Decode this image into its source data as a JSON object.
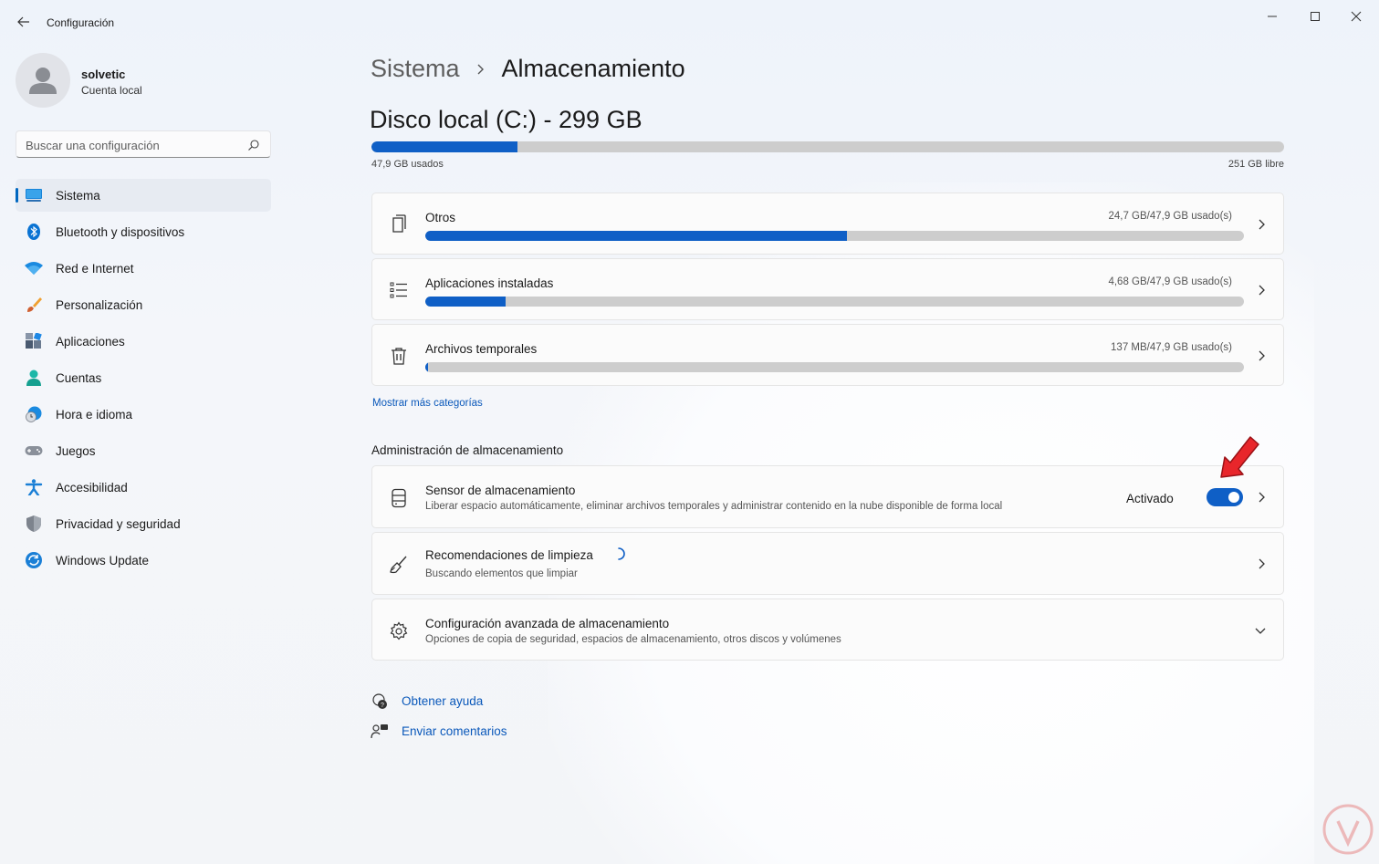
{
  "window": {
    "title": "Configuración",
    "controls": [
      "minimize",
      "maximize",
      "close"
    ]
  },
  "user": {
    "name": "solvetic",
    "account_type": "Cuenta local"
  },
  "search": {
    "placeholder": "Buscar una configuración",
    "value": ""
  },
  "sidebar": {
    "items": [
      {
        "label": "Sistema",
        "icon": "system-icon",
        "active": true
      },
      {
        "label": "Bluetooth y dispositivos",
        "icon": "bluetooth-icon"
      },
      {
        "label": "Red e Internet",
        "icon": "wifi-icon"
      },
      {
        "label": "Personalización",
        "icon": "brush-icon"
      },
      {
        "label": "Aplicaciones",
        "icon": "apps-icon"
      },
      {
        "label": "Cuentas",
        "icon": "account-icon"
      },
      {
        "label": "Hora e idioma",
        "icon": "time-language-icon"
      },
      {
        "label": "Juegos",
        "icon": "gamepad-icon"
      },
      {
        "label": "Accesibilidad",
        "icon": "accessibility-icon"
      },
      {
        "label": "Privacidad y seguridad",
        "icon": "shield-icon"
      },
      {
        "label": "Windows Update",
        "icon": "update-icon"
      }
    ]
  },
  "breadcrumb": {
    "parent": "Sistema",
    "current": "Almacenamiento"
  },
  "disk": {
    "title": "Disco local (C:) - 299 GB",
    "used_label": "47,9 GB usados",
    "free_label": "251 GB libre",
    "used_fraction": 0.16
  },
  "categories": [
    {
      "label": "Otros",
      "size": "24,7 GB/47,9 GB usado(s)",
      "fraction": 0.515,
      "icon": "document-icon"
    },
    {
      "label": "Aplicaciones instaladas",
      "size": "4,68 GB/47,9 GB usado(s)",
      "fraction": 0.098,
      "icon": "list-icon"
    },
    {
      "label": "Archivos temporales",
      "size": "137 MB/47,9 GB usado(s)",
      "fraction": 0.003,
      "icon": "trash-icon"
    }
  ],
  "more_categories": "Mostrar más categorías",
  "management": {
    "section_title": "Administración de almacenamiento",
    "sensor": {
      "title": "Sensor de almacenamiento",
      "description": "Liberar espacio automáticamente, eliminar archivos temporales y administrar contenido en la nube disponible de forma local",
      "state": "Activado",
      "enabled": true
    },
    "cleanup": {
      "title": "Recomendaciones de limpieza",
      "description": "Buscando elementos que limpiar"
    },
    "advanced": {
      "title": "Configuración avanzada de almacenamiento",
      "description": "Opciones de copia de seguridad, espacios de almacenamiento, otros discos y volúmenes"
    }
  },
  "help": {
    "get_help": "Obtener ayuda",
    "feedback": "Enviar comentarios"
  },
  "colors": {
    "accent": "#0f5fc6",
    "link": "#0a58ba",
    "annotation_arrow": "#e8262b"
  }
}
